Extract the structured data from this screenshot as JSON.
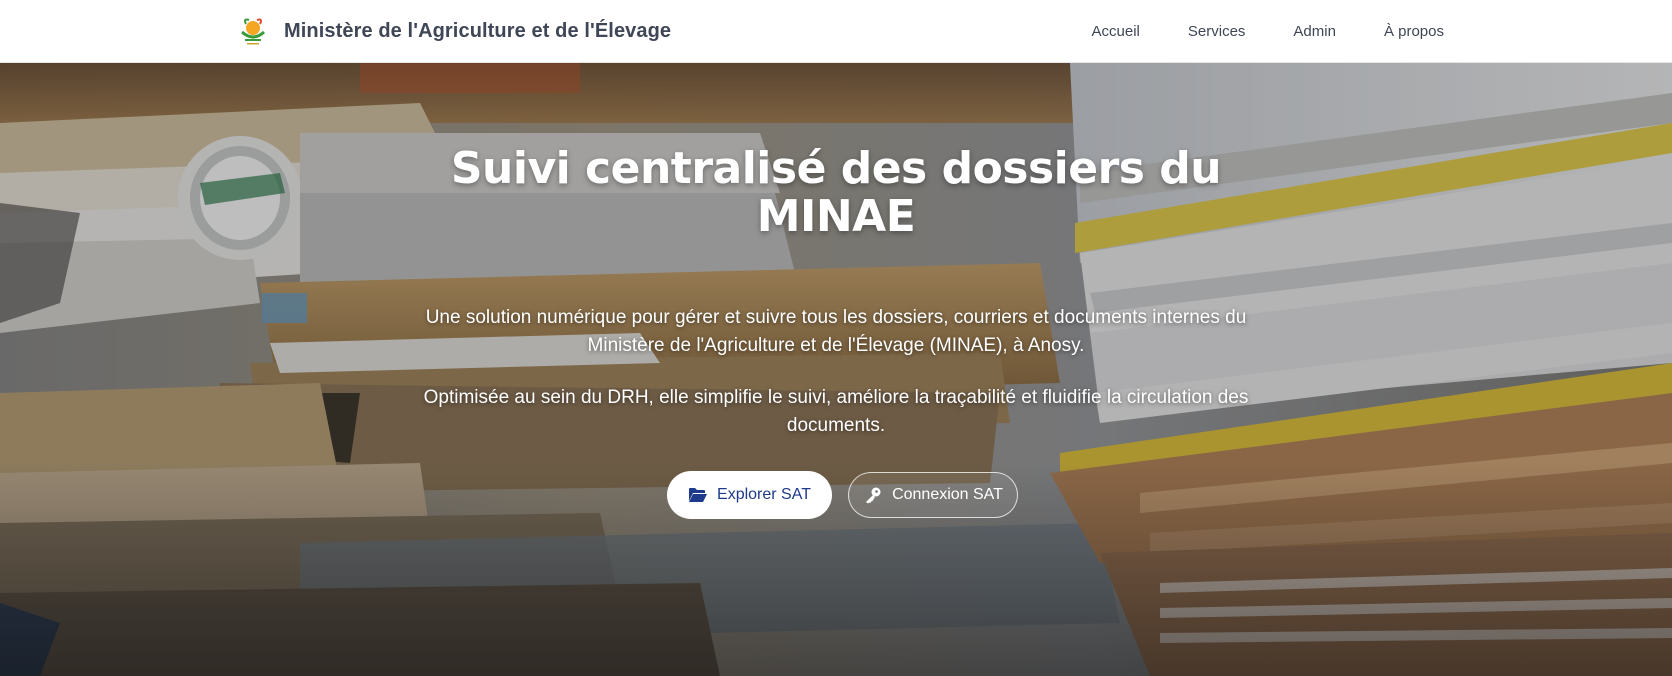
{
  "header": {
    "brand_title": "Ministère de l'Agriculture et de l'Élevage",
    "logo_icon": "ministry-emblem-icon",
    "nav": [
      {
        "label": "Accueil"
      },
      {
        "label": "Services"
      },
      {
        "label": "Admin"
      },
      {
        "label": "À propos"
      }
    ]
  },
  "hero": {
    "title": "Suivi centralisé des dossiers du MINAE",
    "paragraph_1": "Une solution numérique pour gérer et suivre tous les dossiers, courriers et documents internes du Ministère de l'Agriculture et de l'Élevage (MINAE), à Anosy.",
    "paragraph_2": "Optimisée au sein du DRH, elle simplifie le suivi, améliore la traçabilité et fluidifie la circulation des documents.",
    "background_icon": "stacked-files-photo",
    "primary_button": {
      "label": "Explorer SAT",
      "icon": "folder-open-icon"
    },
    "secondary_button": {
      "label": "Connexion SAT",
      "icon": "key-icon"
    }
  },
  "colors": {
    "navbar_bg": "#ffffff",
    "nav_text": "#3f4656",
    "primary_button_text": "#1e3a8a",
    "hero_text": "#ffffff"
  }
}
